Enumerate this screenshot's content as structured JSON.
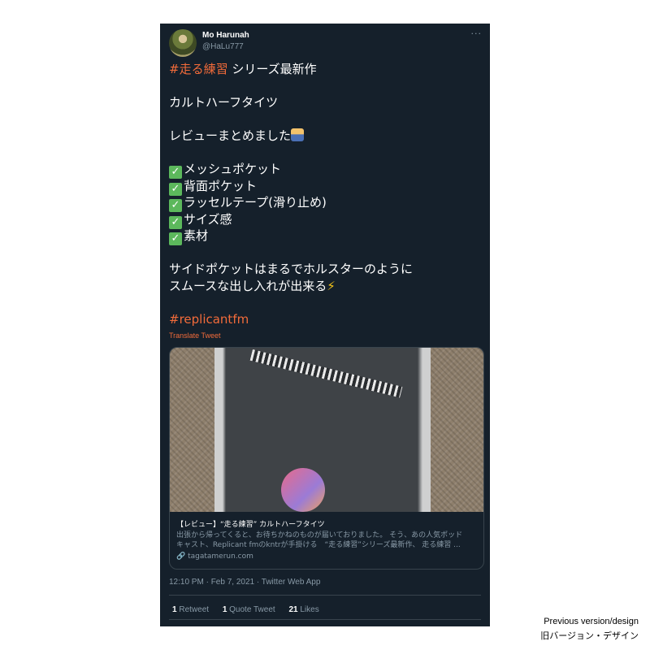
{
  "tweet": {
    "author_name": "Mo Harunah",
    "author_handle": "@HaLu777",
    "more_icon": "···",
    "line1_tag": "#走る練習",
    "line1_rest": " シリーズ最新作",
    "line2": "カルトハーフタイツ",
    "line3": "レビューまとめました",
    "checklist": [
      "メッシュポケット",
      "背面ポケット",
      "ラッセルテープ(滑り止め)",
      "サイズ感",
      "素材"
    ],
    "check_glyph": "✓",
    "closing_line1": "サイドポケットはまるでホルスターのように",
    "closing_line2": "スムースな出し入れが出来る",
    "bolt": "⚡",
    "hashtag2": "#replicantfm",
    "translate_label": "Translate Tweet",
    "card": {
      "title": "【レビュー】“走る練習” カルトハーフタイツ",
      "description_line1": "出張から帰ってくると、お待ちかねのものが届いておりました。 そう、あの人気ポッド",
      "description_line2": "キャスト、Replicant fmのkntrが手掛ける　“走る練習”シリーズ最新作、 走る練習 ...",
      "link_icon": "🔗",
      "domain": "tagatamerun.com"
    },
    "timestamp": "12:10 PM · Feb 7, 2021 · Twitter Web App",
    "retweets_count": "1",
    "retweets_label": "Retweet",
    "quotes_count": "1",
    "quotes_label": "Quote Tweet",
    "likes_count": "21",
    "likes_label": "Likes"
  },
  "caption": {
    "line1": "Previous version/design",
    "line2": "旧バージョン・デザイン"
  },
  "colors": {
    "background": "#15202b",
    "accent": "#f26b3a",
    "secondary_text": "#8899a6",
    "border": "#38444d"
  }
}
